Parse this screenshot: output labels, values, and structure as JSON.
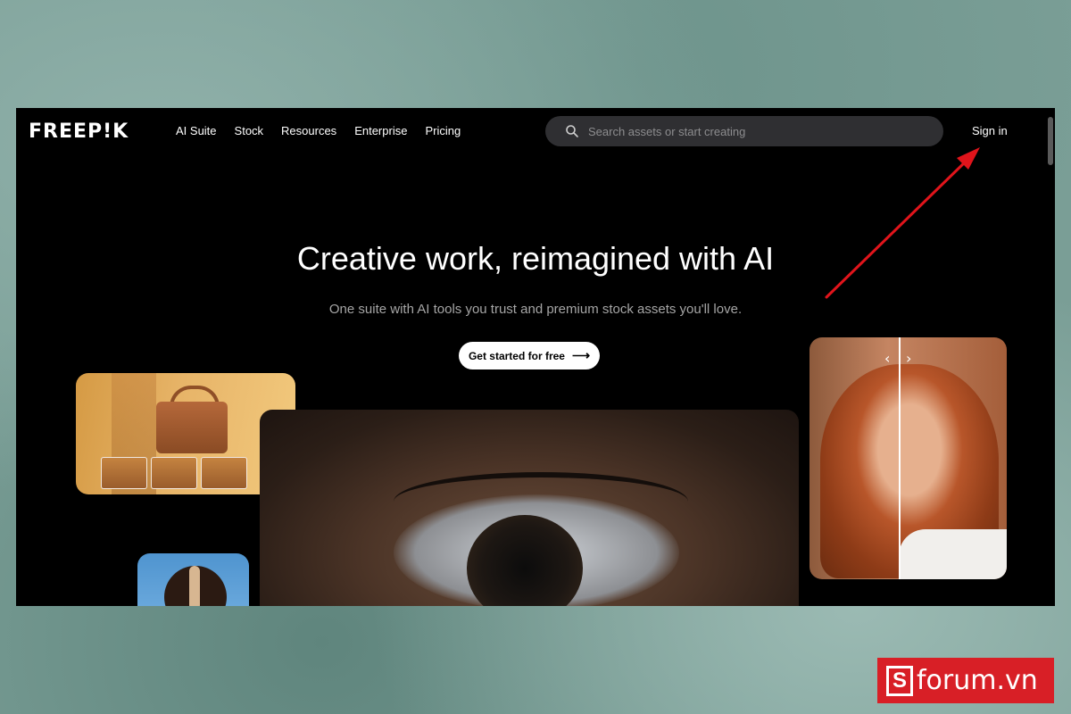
{
  "header": {
    "logo": "FREEP!K",
    "nav": [
      "AI Suite",
      "Stock",
      "Resources",
      "Enterprise",
      "Pricing"
    ],
    "search_placeholder": "Search assets or start creating",
    "sign_in": "Sign in"
  },
  "hero": {
    "title": "Creative work, reimagined with AI",
    "subtitle": "One suite with AI tools you trust and premium stock assets you'll love.",
    "cta": "Get started for free",
    "cta_arrow": "⟶"
  },
  "comparison": {
    "prev": "‹",
    "next": "›"
  },
  "watermark": {
    "letter": "S",
    "text": "forum.vn"
  },
  "colors": {
    "annotation_arrow": "#e0141b",
    "badge": "#d81f26"
  }
}
